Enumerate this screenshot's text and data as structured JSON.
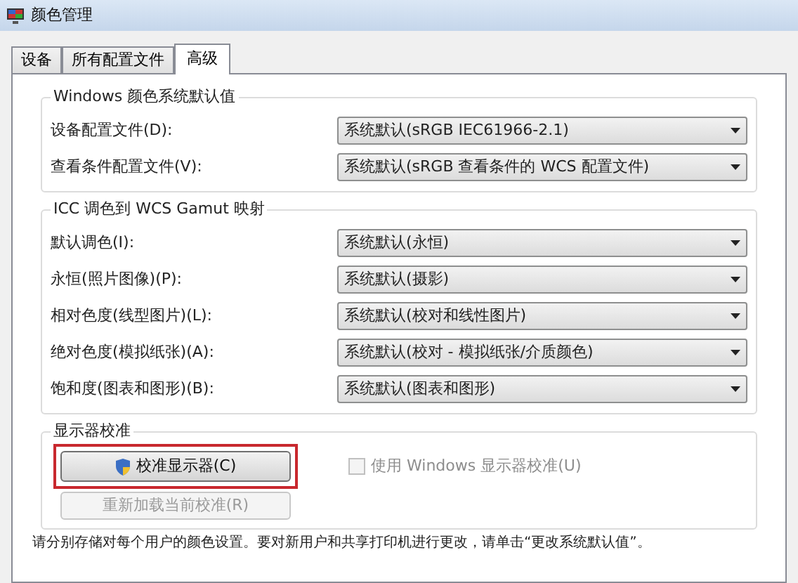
{
  "window": {
    "title": "颜色管理"
  },
  "tabs": [
    {
      "label": "设备",
      "selected": false
    },
    {
      "label": "所有配置文件",
      "selected": false
    },
    {
      "label": "高级",
      "selected": true
    }
  ],
  "groups": [
    {
      "title": "Windows 颜色系统默认值",
      "rows": [
        {
          "label": "设备配置文件(D):",
          "value": "系统默认(sRGB IEC61966-2.1)"
        },
        {
          "label": "查看条件配置文件(V):",
          "value": "系统默认(sRGB 查看条件的 WCS 配置文件)"
        }
      ]
    },
    {
      "title": "ICC 调色到 WCS Gamut 映射",
      "rows": [
        {
          "label": "默认调色(I):",
          "value": "系统默认(永恒)"
        },
        {
          "label": "永恒(照片图像)(P):",
          "value": "系统默认(摄影)"
        },
        {
          "label": "相对色度(线型图片)(L):",
          "value": "系统默认(校对和线性图片)"
        },
        {
          "label": "绝对色度(模拟纸张)(A):",
          "value": "系统默认(校对 - 模拟纸张/介质颜色)"
        },
        {
          "label": "饱和度(图表和图形)(B):",
          "value": "系统默认(图表和图形)"
        }
      ]
    }
  ],
  "calibration": {
    "title": "显示器校准",
    "calibrate_button": {
      "label": "校准显示器(C)",
      "highlighted": true,
      "disabled": false
    },
    "checkbox": {
      "label": "使用 Windows 显示器校准(U)",
      "checked": false,
      "disabled": true
    },
    "reload_button": {
      "label": "重新加载当前校准(R)",
      "disabled": true
    }
  },
  "footer": "请分别存储对每个用户的颜色设置。要对新用户和共享打印机进行更改，请单击“更改系统默认值”。"
}
